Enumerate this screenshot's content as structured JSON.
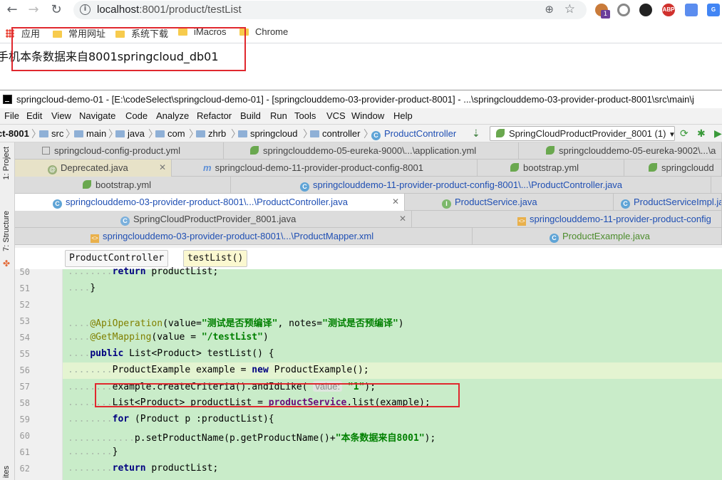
{
  "browser": {
    "url_host": "localhost",
    "url_path": ":8001/product/testList",
    "bookmarks": [
      "应用",
      "常用网址",
      "系统下载",
      "iMacros",
      "Chrome"
    ],
    "extension_badge": "1",
    "extensions": [
      "ABP"
    ]
  },
  "page": {
    "body_text": "手机本条数据来自8001springcloud_db01"
  },
  "ide": {
    "title": "springcloud-demo-01 - [E:\\codeSelect\\springcloud-demo-01] - [springclouddemo-03-provider-product-8001] - ...\\springclouddemo-03-provider-product-8001\\src\\main\\j",
    "menu": [
      "File",
      "Edit",
      "View",
      "Navigate",
      "Code",
      "Analyze",
      "Refactor",
      "Build",
      "Run",
      "Tools",
      "VCS",
      "Window",
      "Help"
    ],
    "breadcrumbs": [
      "ct-8001",
      "src",
      "main",
      "java",
      "com",
      "zhrb",
      "springcloud",
      "controller",
      "ProductController"
    ],
    "run_config": "SpringCloudProductProvider_8001 (1)",
    "side_tabs": [
      "1: Project",
      "7: Structure",
      "ites"
    ],
    "tabs_row1": [
      "springcloud-config-product.yml",
      "springclouddemo-05-eureka-9000\\...\\application.yml",
      "springclouddemo-05-eureka-9002\\...\\a"
    ],
    "tabs_row2": [
      "Deprecated.java",
      "springcloud-demo-11-provider-product-config-8001",
      "bootstrap.yml",
      "springcloudd"
    ],
    "tabs_row3": [
      "bootstrap.yml",
      "springclouddemo-11-provider-product-config-8001\\...\\ProductController.java"
    ],
    "tabs_row4": [
      "springclouddemo-03-provider-product-8001\\...\\ProductController.java",
      "ProductService.java",
      "ProductServiceImpl.java"
    ],
    "tabs_row5": [
      "SpringCloudProductProvider_8001.java",
      "springclouddemo-11-provider-product-config"
    ],
    "tabs_row6": [
      "springclouddemo-03-provider-product-8001\\...\\ProductMapper.xml",
      "ProductExample.java"
    ],
    "code_crumbs": [
      "ProductController",
      "testList()"
    ],
    "code_lines": [
      {
        "n": "50",
        "indent": 2,
        "parts": [
          [
            "kw",
            "return"
          ],
          [
            "",
            " productList;"
          ]
        ]
      },
      {
        "n": "51",
        "indent": 1,
        "parts": [
          [
            "",
            "}"
          ]
        ]
      },
      {
        "n": "52",
        "indent": 0,
        "parts": []
      },
      {
        "n": "53",
        "indent": 1,
        "parts": [
          [
            "anno",
            "@ApiOperation"
          ],
          [
            "",
            "(value="
          ],
          [
            "str",
            "\"测试是否预编译\""
          ],
          [
            "",
            ", notes="
          ],
          [
            "str",
            "\"测试是否预编译\""
          ],
          [
            "",
            ")"
          ]
        ]
      },
      {
        "n": "54",
        "indent": 1,
        "parts": [
          [
            "anno",
            "@GetMapping"
          ],
          [
            "",
            "(value = "
          ],
          [
            "str",
            "\"/testList\""
          ],
          [
            "",
            ")"
          ]
        ]
      },
      {
        "n": "55",
        "indent": 1,
        "parts": [
          [
            "kw",
            "public"
          ],
          [
            "",
            " List<Product> testList() {"
          ]
        ]
      },
      {
        "n": "56",
        "indent": 2,
        "parts": [
          [
            "",
            "ProductExample example = "
          ],
          [
            "kw",
            "new"
          ],
          [
            "",
            " ProductExample();"
          ]
        ]
      },
      {
        "n": "57",
        "indent": 2,
        "parts": [
          [
            "",
            "example.createCriteria().andIdLike( "
          ],
          [
            "hint",
            "value:"
          ],
          [
            "str",
            " \"1\""
          ],
          [
            "",
            ");"
          ]
        ]
      },
      {
        "n": "58",
        "indent": 2,
        "parts": [
          [
            "",
            "List<Product> productList = "
          ],
          [
            "field",
            "productService"
          ],
          [
            "",
            ".list(example);"
          ]
        ]
      },
      {
        "n": "59",
        "indent": 2,
        "parts": [
          [
            "kw",
            "for"
          ],
          [
            "",
            " (Product p :productList){"
          ]
        ]
      },
      {
        "n": "60",
        "indent": 3,
        "parts": [
          [
            "",
            "p.setProductName(p.getProductName()+"
          ],
          [
            "str",
            "\"本条数据来自8001\""
          ],
          [
            "",
            ");"
          ]
        ]
      },
      {
        "n": "61",
        "indent": 2,
        "parts": [
          [
            "",
            "}"
          ]
        ]
      },
      {
        "n": "62",
        "indent": 2,
        "parts": [
          [
            "kw",
            "return"
          ],
          [
            "",
            " productList;"
          ]
        ]
      }
    ]
  },
  "colors": {
    "highlight_red": "#e0282e",
    "code_bg": "#c9ecc9",
    "keyword": "#000080",
    "string": "#008000",
    "annotation": "#808000"
  }
}
